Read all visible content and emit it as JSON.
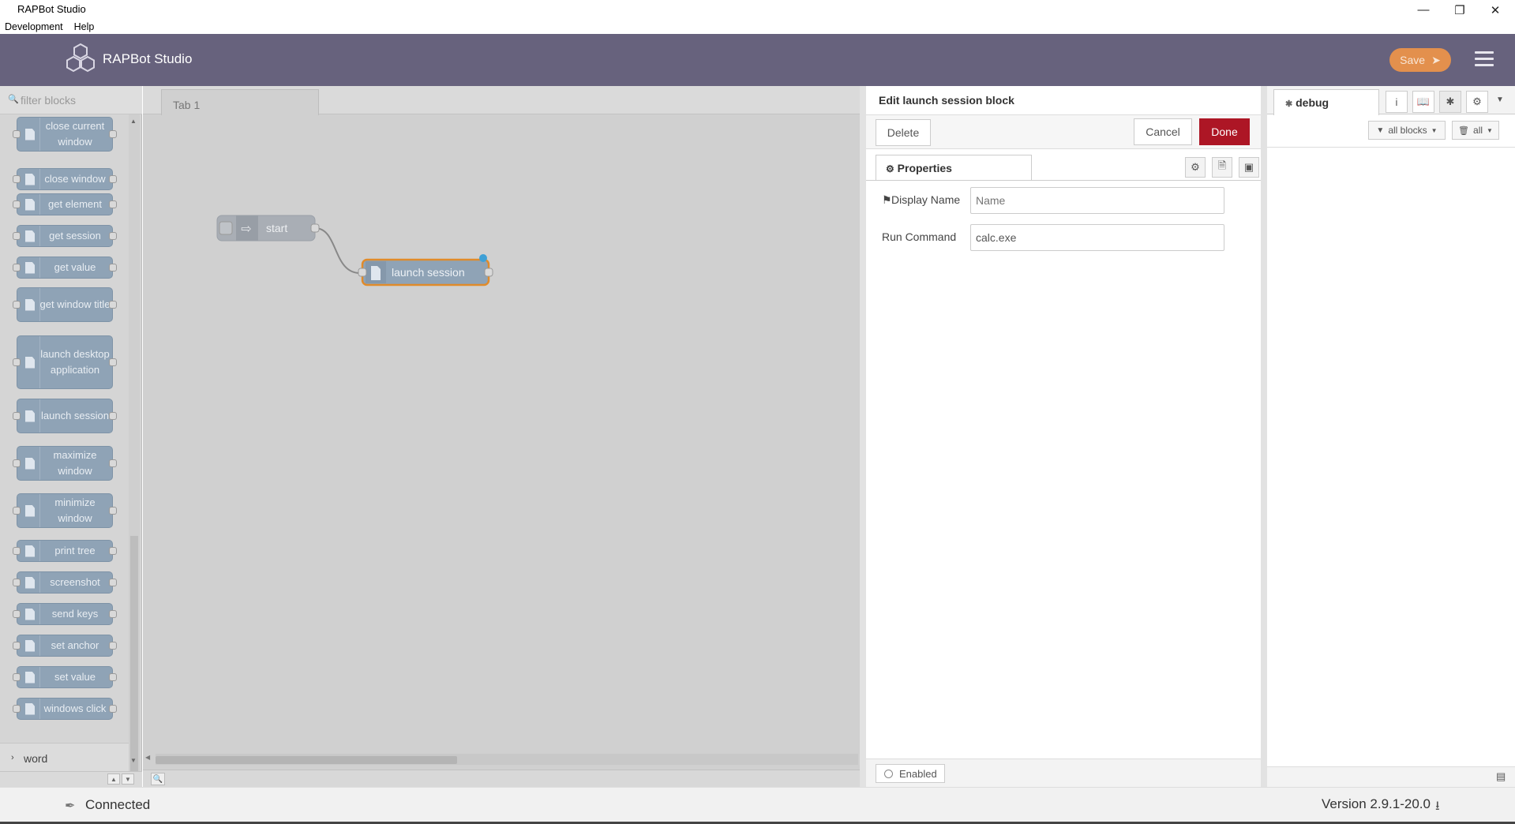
{
  "window": {
    "title": "RAPBot Studio"
  },
  "menubar": {
    "items": [
      "Development",
      "Help"
    ]
  },
  "header": {
    "brand": "RAPBot Studio",
    "save_label": "Save"
  },
  "palette": {
    "filter_placeholder": "filter blocks",
    "blocks": [
      "close current window",
      "close window",
      "get element",
      "get session",
      "get value",
      "get window title",
      "launch desktop application",
      "launch session",
      "maximize window",
      "minimize window",
      "print tree",
      "screenshot",
      "send keys",
      "set anchor",
      "set value",
      "windows click"
    ],
    "category_word": "word"
  },
  "workspace": {
    "tab_label": "Tab 1",
    "nodes": {
      "start": "start",
      "launch": "launch session"
    }
  },
  "editor": {
    "title": "Edit launch session block",
    "delete_label": "Delete",
    "cancel_label": "Cancel",
    "done_label": "Done",
    "properties_tab": "Properties",
    "display_name_label": "Display Name",
    "display_name_placeholder": "Name",
    "display_name_value": "",
    "run_command_label": "Run Command",
    "run_command_value": "calc.exe",
    "enabled_label": "Enabled"
  },
  "sidebar": {
    "tab_label": "debug",
    "filter_label": "all blocks",
    "clear_label": "all"
  },
  "status": {
    "connection": "Connected",
    "version": "Version 2.9.1-20.0"
  },
  "colors": {
    "header": "#67627d",
    "save": "#e3904d",
    "done": "#ad1625",
    "block": "#8fa3b6",
    "selected_outline": "#e08b2b"
  }
}
